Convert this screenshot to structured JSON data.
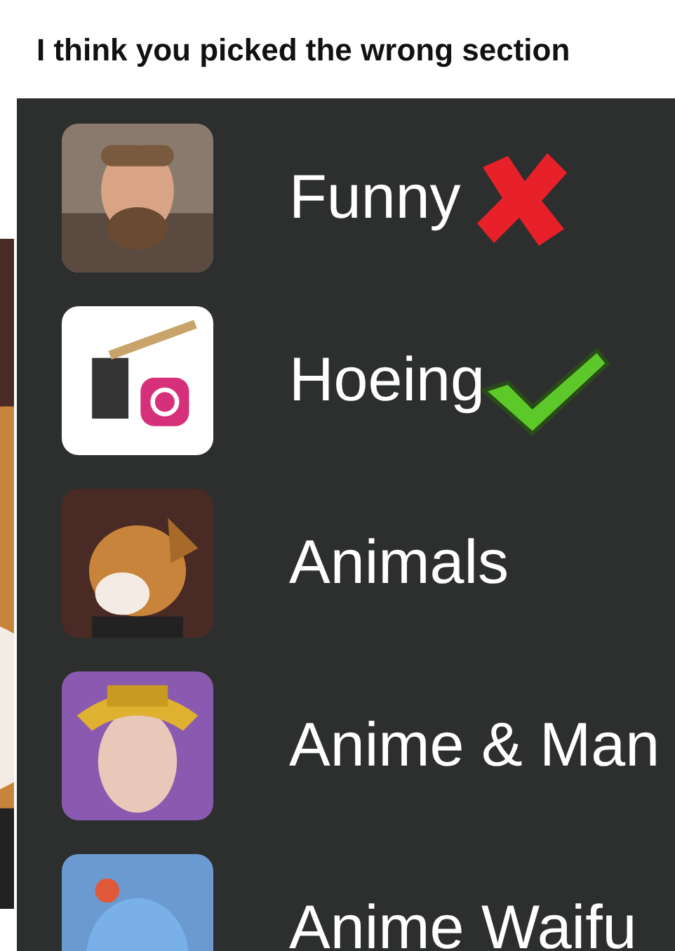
{
  "caption": "I think you picked the wrong section",
  "sections": [
    {
      "label": "Funny",
      "mark": {
        "kind": "cross"
      }
    },
    {
      "label": "Hoeing",
      "mark": {
        "kind": "check"
      }
    },
    {
      "label": "Animals"
    },
    {
      "label": "Anime & Man"
    },
    {
      "label": "Anime Waifu"
    }
  ]
}
